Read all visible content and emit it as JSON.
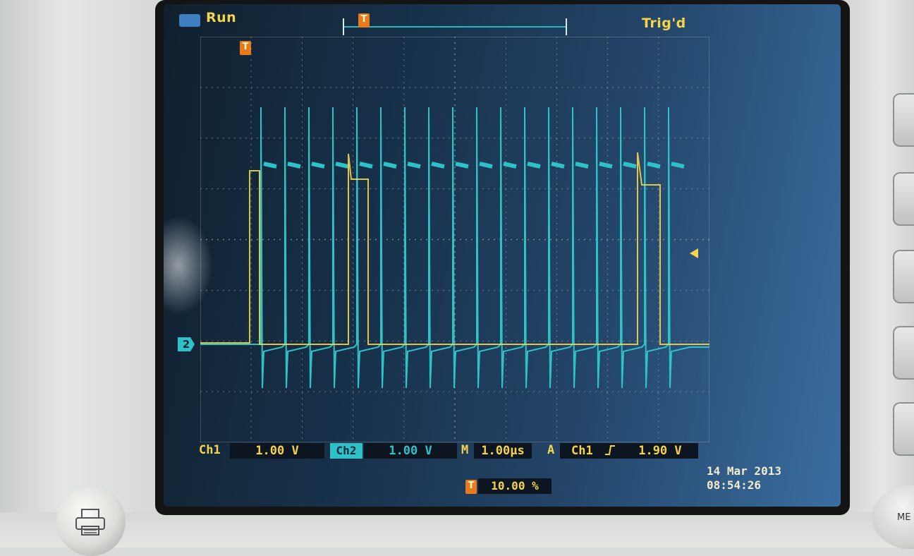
{
  "header": {
    "run_label": "Run",
    "trig_status": "Trig'd",
    "trigger_marker": "T"
  },
  "channel2_marker": "2",
  "status_bar": {
    "ch1_label": "Ch1",
    "ch1_scale": "1.00 V",
    "ch2_label": "Ch2",
    "ch2_scale": "1.00 V",
    "timebase_label": "M",
    "timebase_value": "1.00µs",
    "trigger_label": "A",
    "trigger_source": "Ch1",
    "trigger_slope_icon": "rising-edge-icon",
    "trigger_level": "1.90 V"
  },
  "trigger_position": {
    "marker": "T",
    "value": "10.00 %"
  },
  "datetime": {
    "date": "14 Mar 2013",
    "time": "08:54:26"
  },
  "colors": {
    "ch1_trace": "#f5d44a",
    "ch2_trace": "#2ec2c8",
    "screen_bg": "#18324c"
  },
  "softkey_label": "ME"
}
